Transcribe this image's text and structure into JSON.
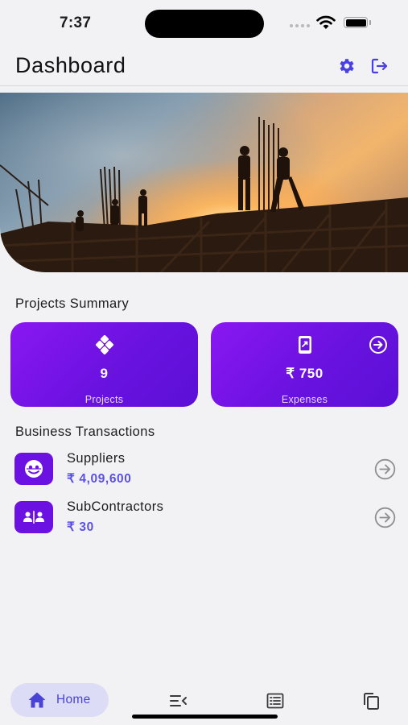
{
  "status": {
    "time": "7:37"
  },
  "header": {
    "title": "Dashboard"
  },
  "summary": {
    "title": "Projects Summary",
    "projects": {
      "value": "9",
      "label": "Projects"
    },
    "expenses": {
      "value": "₹ 750",
      "label": "Expenses"
    }
  },
  "transactions": {
    "title": "Business Transactions",
    "items": [
      {
        "name": "Suppliers",
        "amount": "₹ 4,09,600"
      },
      {
        "name": "SubContractors",
        "amount": "₹ 30"
      }
    ]
  },
  "tabbar": {
    "home_label": "Home"
  },
  "colors": {
    "accent": "#5b50e6",
    "card_gradient_start": "#8a17f2",
    "card_gradient_end": "#5b10d6",
    "icon_bg": "#6b12e3",
    "home_pill": "#dcdcf7"
  },
  "icons": {
    "settings": "gear-icon",
    "logout": "logout-icon",
    "projects": "diamond-grid-icon",
    "expenses": "phone-transfer-icon",
    "arrow": "arrow-circle-right-icon",
    "suppliers": "supplier-face-icon",
    "subcontractors": "users-split-icon",
    "home": "home-icon",
    "menu": "menu-collapse-icon",
    "list": "list-alt-icon",
    "copy": "copy-icon"
  }
}
